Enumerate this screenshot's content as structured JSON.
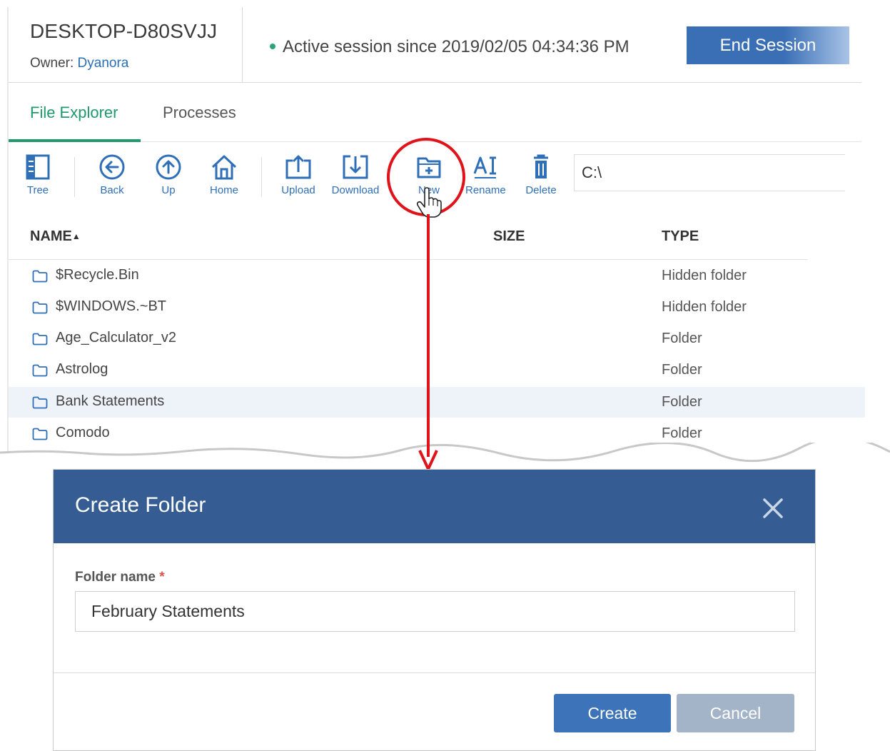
{
  "header": {
    "hostname": "DESKTOP-D80SVJJ",
    "owner_label": "Owner:",
    "owner_name": "Dyanora",
    "session_status": "Active session since 2019/02/05 04:34:36 PM",
    "end_session_label": "End Session"
  },
  "tabs": [
    {
      "label": "File Explorer",
      "active": true
    },
    {
      "label": "Processes",
      "active": false
    }
  ],
  "toolbar": {
    "tree": "Tree",
    "back": "Back",
    "up": "Up",
    "home": "Home",
    "upload": "Upload",
    "download": "Download",
    "new": "New",
    "rename": "Rename",
    "delete": "Delete",
    "path": "C:\\"
  },
  "table": {
    "columns": [
      "NAME",
      "SIZE",
      "TYPE"
    ],
    "sort_indicator": "▲",
    "rows": [
      {
        "name": "$Recycle.Bin",
        "size": "",
        "type": "Hidden folder"
      },
      {
        "name": "$WINDOWS.~BT",
        "size": "",
        "type": "Hidden folder"
      },
      {
        "name": "Age_Calculator_v2",
        "size": "",
        "type": "Folder"
      },
      {
        "name": "Astrolog",
        "size": "",
        "type": "Folder"
      },
      {
        "name": "Bank Statements",
        "size": "",
        "type": "Folder"
      },
      {
        "name": "Comodo",
        "size": "",
        "type": "Folder"
      }
    ]
  },
  "dialog": {
    "title": "Create Folder",
    "field_label": "Folder name",
    "required_mark": "*",
    "field_value": "February Statements",
    "create_label": "Create",
    "cancel_label": "Cancel"
  },
  "colors": {
    "accent_green": "#1e9a6b",
    "toolbar_blue": "#2f6fb8",
    "dialog_header": "#355d93",
    "highlight_red": "#e0121a"
  }
}
